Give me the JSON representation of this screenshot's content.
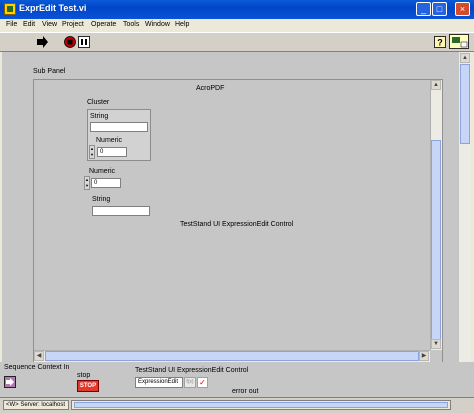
{
  "window": {
    "title": "ExprEdit Test.vi",
    "minimize": "_",
    "maximize": "□",
    "close": "×"
  },
  "menu": [
    "File",
    "Edit",
    "View",
    "Project",
    "Operate",
    "Tools",
    "Window",
    "Help"
  ],
  "panel": {
    "subpanel_label": "Sub Panel",
    "acropdf_label": "AcroPDF",
    "cluster": {
      "label": "Cluster",
      "string_label": "String",
      "string_value": "",
      "numeric_label": "Numeric",
      "numeric_value": "0"
    },
    "numeric": {
      "label": "Numeric",
      "value": "0"
    },
    "string": {
      "label": "String",
      "value": ""
    },
    "control_caption": "TestStand UI ExpressionEdit Control"
  },
  "bottom": {
    "sequence_context_label": "Sequence Context In",
    "stop_label": "stop",
    "stop_button": "STOP",
    "expr_control_label": "TestStand UI ExpressionEdit Control",
    "expr_value": "ExpressionEdit",
    "fx_label": "f(x)",
    "check_label": "✓",
    "error_out_label": "error out"
  },
  "status": {
    "server": "<W> Server: localhost"
  }
}
